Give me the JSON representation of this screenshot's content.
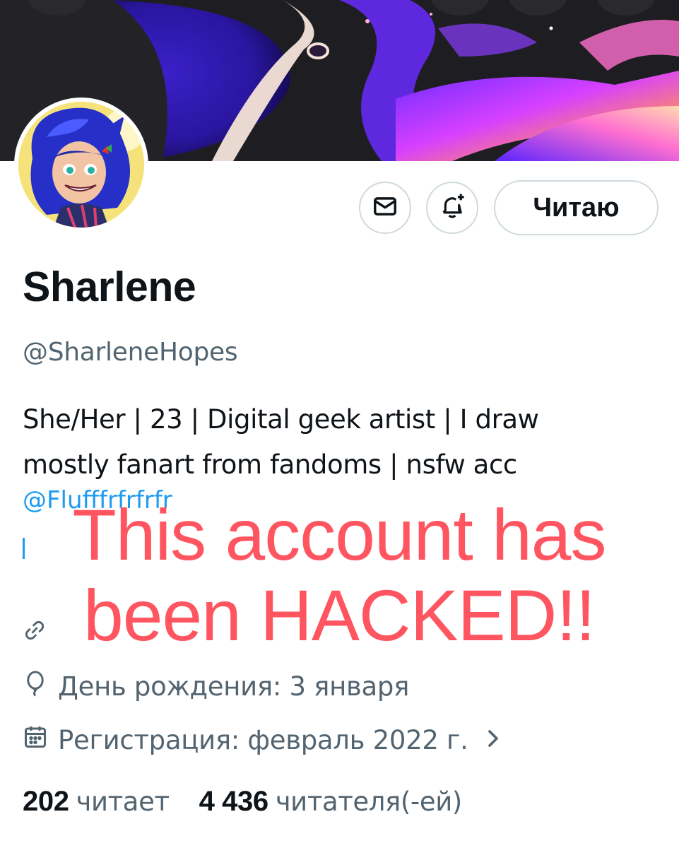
{
  "profile": {
    "display_name": "Sharlene",
    "handle": "@SharleneHopes",
    "bio_line1": "She/Her | 23 | Digital geek artist | I draw",
    "bio_line2": "mostly fanart from fandoms | nsfw acc",
    "bio_link": "@Flufffrfrfrfr",
    "birthday": "День рождения: 3 января",
    "joined": "Регистрация: февраль 2022 г."
  },
  "actions": {
    "message_icon": "envelope-icon",
    "notify_icon": "bell-plus-icon",
    "follow_label": "Читаю"
  },
  "stats": {
    "following_count": "202",
    "following_label": "читает",
    "followers_count": "4 436",
    "followers_label": "читателя(-ей)"
  },
  "overlay": {
    "line1": "This account has",
    "line2": "been HACKED!!",
    "color": "#ff5560"
  },
  "colors": {
    "link": "#1d9bf0",
    "secondary_text": "#536471",
    "border": "#cfd9de"
  }
}
